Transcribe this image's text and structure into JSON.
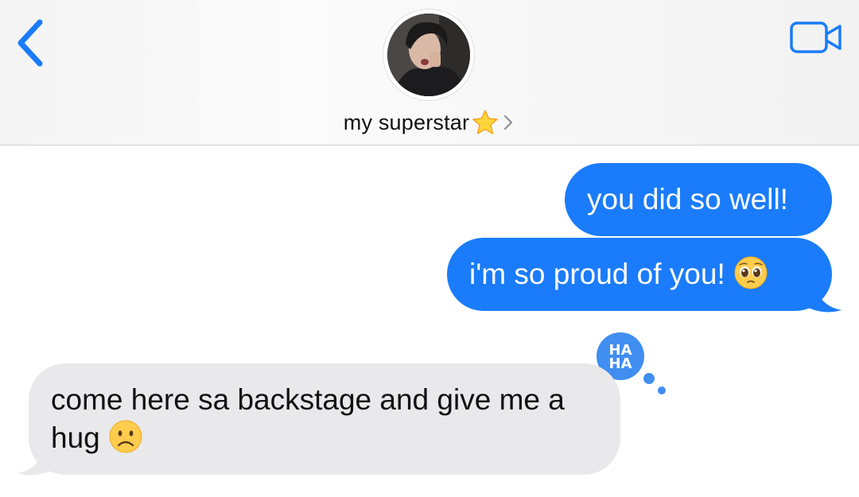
{
  "header": {
    "contact_name": "my superstar",
    "contact_emoji": "star-emoji",
    "back_icon": "chevron-left-icon",
    "video_icon": "video-camera-icon",
    "accent_color": "#1a7cfa"
  },
  "messages": [
    {
      "direction": "outgoing",
      "text": "you did so well!"
    },
    {
      "direction": "outgoing",
      "text": "i'm so proud of you!",
      "emoji": "pleading-face-emoji"
    },
    {
      "direction": "incoming",
      "text": "come here sa backstage and give me a hug",
      "emoji": "frowning-face-emoji"
    }
  ],
  "tapback": {
    "text_line1": "HA",
    "text_line2": "HA",
    "color": "#3f8ef0"
  },
  "colors": {
    "outgoing_bubble": "#1a7cfa",
    "incoming_bubble": "#e9e9eb"
  }
}
